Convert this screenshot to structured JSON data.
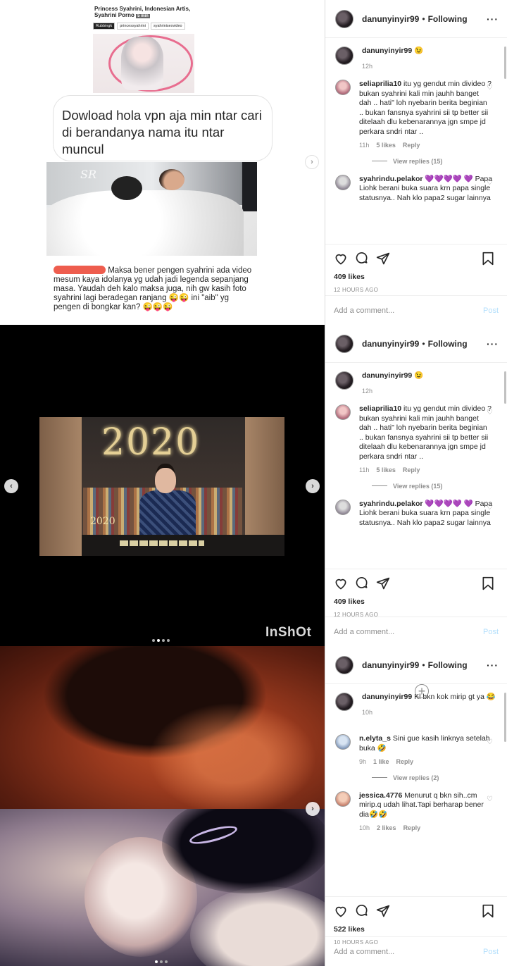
{
  "panels": [
    {
      "media": {
        "card_title": "Princess Syahrini, Indonesian Artis, Syahrini Porno",
        "card_duration": "5 min",
        "card_tags": [
          "Rubbingk",
          "princessyahrini",
          "syahrinisexvideo"
        ],
        "bubble_text": "Dowload hola vpn aja min ntar cari di berandanya  nama itu ntar muncul",
        "caption": "Maksa bener pengen syahrini ada video mesum kaya idolanya yg udah jadi legenda sepanjang masa. Yaudah deh kalo maksa juga, nih gw kasih foto syahrini lagi beradegan ranjang 😜😜 ini \"aib\" yg pengen di bongkar kan? 😜😜😜"
      },
      "header": {
        "username": "danunyinyir99",
        "separator": "•",
        "follow_label": "Following"
      },
      "caption_comment": {
        "username": "danunyinyir99",
        "text": "😉",
        "time": "12h"
      },
      "comments": [
        {
          "username": "seliaprilia10",
          "text": "itu yg gendut min divideo ? bukan syahrini kali min jauhh banget dah .. hati\" loh nyebarin berita beginian .. bukan fansnya syahrini sii tp better sii ditelaah dlu kebenarannya jgn smpe jd perkara sndri ntar ..",
          "time": "11h",
          "likes": "5 likes",
          "reply": "Reply",
          "view_replies": "View replies (15)"
        },
        {
          "username": "syahrindu.pelakor",
          "text": "💜💜💜💜 💜 Papa Liohk berani buka suara krn papa single statusnya.. Nah klo papa2 sugar lainnya"
        }
      ],
      "likes": "409 likes",
      "timestamp": "12 HOURS AGO",
      "add_comment_placeholder": "Add a comment...",
      "post_label": "Post"
    },
    {
      "media": {
        "video_title": "2020",
        "video_small_title": "2020",
        "watermark": "InShOt"
      },
      "header": {
        "username": "danunyinyir99",
        "separator": "•",
        "follow_label": "Following"
      },
      "caption_comment": {
        "username": "danunyinyir99",
        "text": "😉",
        "time": "12h"
      },
      "comments": [
        {
          "username": "seliaprilia10",
          "text": "itu yg gendut min divideo ? bukan syahrini kali min jauhh banget dah .. hati\" loh nyebarin berita beginian .. bukan fansnya syahrini sii tp better sii ditelaah dlu kebenarannya jgn smpe jd perkara sndri ntar ..",
          "time": "11h",
          "likes": "5 likes",
          "reply": "Reply",
          "view_replies": "View replies (15)"
        },
        {
          "username": "syahrindu.pelakor",
          "text": "💜💜💜💜 💜 Papa Liohk berani buka suara krn papa single statusnya.. Nah klo papa2 sugar lainnya"
        }
      ],
      "likes": "409 likes",
      "timestamp": "12 HOURS AGO",
      "add_comment_placeholder": "Add a comment...",
      "post_label": "Post"
    },
    {
      "header": {
        "username": "danunyinyir99",
        "separator": "•",
        "follow_label": "Following"
      },
      "caption_comment": {
        "username": "danunyinyir99",
        "text": "Kl bkn kok mirip gt ya 😂",
        "time": "10h"
      },
      "load_more": "+",
      "comments": [
        {
          "username": "n.elyta_s",
          "text": "Sini gue kasih linknya setelah buka 🤣",
          "time": "9h",
          "likes": "1 like",
          "reply": "Reply",
          "view_replies": "View replies (2)"
        },
        {
          "username": "jessica.4776",
          "text": "Menurut q bkn sih..cm mirip.q udah lihat.Tapi berharap bener dia🤣🤣",
          "time": "10h",
          "likes": "2 likes",
          "reply": "Reply"
        }
      ],
      "likes": "522 likes",
      "timestamp": "10 HOURS AGO",
      "add_comment_placeholder": "Add a comment...",
      "post_label": "Post"
    }
  ],
  "icons": {
    "heart": "heart-icon",
    "comment": "comment-icon",
    "share": "share-icon",
    "bookmark": "bookmark-icon",
    "more": "more-options-icon"
  },
  "colors": {
    "text": "#262626",
    "muted": "#8e8e8e",
    "post_disabled": "#b2dffc",
    "border": "#dbdbdb"
  }
}
